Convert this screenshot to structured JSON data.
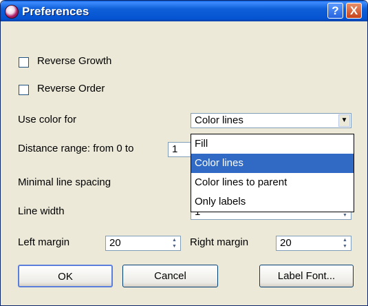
{
  "window": {
    "title": "Preferences",
    "help_label": "?",
    "close_label": "X"
  },
  "options": {
    "reverse_growth_label": "Reverse Growth",
    "reverse_order_label": "Reverse Order",
    "use_color_for_label": "Use color for",
    "use_color_for_value": "Color lines",
    "dropdown_options": [
      "Fill",
      "Color lines",
      "Color lines to parent",
      "Only labels"
    ],
    "distance_range_label": "Distance range: from 0 to",
    "distance_range_value": "1",
    "minimal_line_spacing_label": "Minimal line spacing",
    "line_width_label": "Line width",
    "line_width_value": "1",
    "left_margin_label": "Left margin",
    "left_margin_value": "20",
    "right_margin_label": "Right margin",
    "right_margin_value": "20"
  },
  "buttons": {
    "ok": "OK",
    "cancel": "Cancel",
    "label_font": "Label Font..."
  },
  "colors": {
    "titlebar": "#0553d1",
    "selection": "#316ac5",
    "dialog_bg": "#ece9d8"
  }
}
